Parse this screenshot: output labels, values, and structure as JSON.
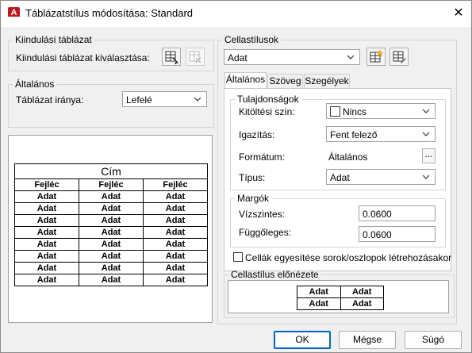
{
  "window": {
    "title": "Táblázatstílus módosítása: Standard",
    "app_icon_letter": "A"
  },
  "start_table": {
    "legend": "Kiindulási táblázat",
    "select_label": "Kiindulási táblázat kiválasztása:"
  },
  "general": {
    "legend": "Általános",
    "direction_label": "Táblázat iránya:",
    "direction_value": "Lefelé"
  },
  "preview": {
    "title": "Cím",
    "headers": [
      "Fejléc",
      "Fejléc",
      "Fejléc"
    ],
    "rows": [
      [
        "Adat",
        "Adat",
        "Adat"
      ],
      [
        "Adat",
        "Adat",
        "Adat"
      ],
      [
        "Adat",
        "Adat",
        "Adat"
      ],
      [
        "Adat",
        "Adat",
        "Adat"
      ],
      [
        "Adat",
        "Adat",
        "Adat"
      ],
      [
        "Adat",
        "Adat",
        "Adat"
      ],
      [
        "Adat",
        "Adat",
        "Adat"
      ],
      [
        "Adat",
        "Adat",
        "Adat"
      ]
    ]
  },
  "cell_styles": {
    "legend": "Cellastílusok",
    "selected": "Adat",
    "tabs": [
      "Általános",
      "Szöveg",
      "Szegélyek"
    ]
  },
  "properties": {
    "legend": "Tulajdonságok",
    "fill_label": "Kitöltési szín:",
    "fill_value": "Nincs",
    "align_label": "Igazítás:",
    "align_value": "Fent felező",
    "format_label": "Formátum:",
    "format_value": "Általános",
    "format_button": "...",
    "type_label": "Típus:",
    "type_value": "Adat"
  },
  "margins": {
    "legend": "Margók",
    "horizontal_label": "Vízszintes:",
    "horizontal_value": "0.0600",
    "vertical_label": "Függőleges:",
    "vertical_value": "0.0600"
  },
  "merge_checkbox_label": "Cellák egyesítése sorok/oszlopok létrehozásakor",
  "cell_preview": {
    "legend": "Cellastílus előnézete",
    "rows": [
      [
        "Adat",
        "Adat"
      ],
      [
        "Adat",
        "Adat"
      ]
    ]
  },
  "buttons": {
    "ok": "OK",
    "cancel": "Mégse",
    "help": "Súgó"
  },
  "colors": {
    "app_icon": "#c4161c",
    "default_button_border": "#0067c0"
  }
}
